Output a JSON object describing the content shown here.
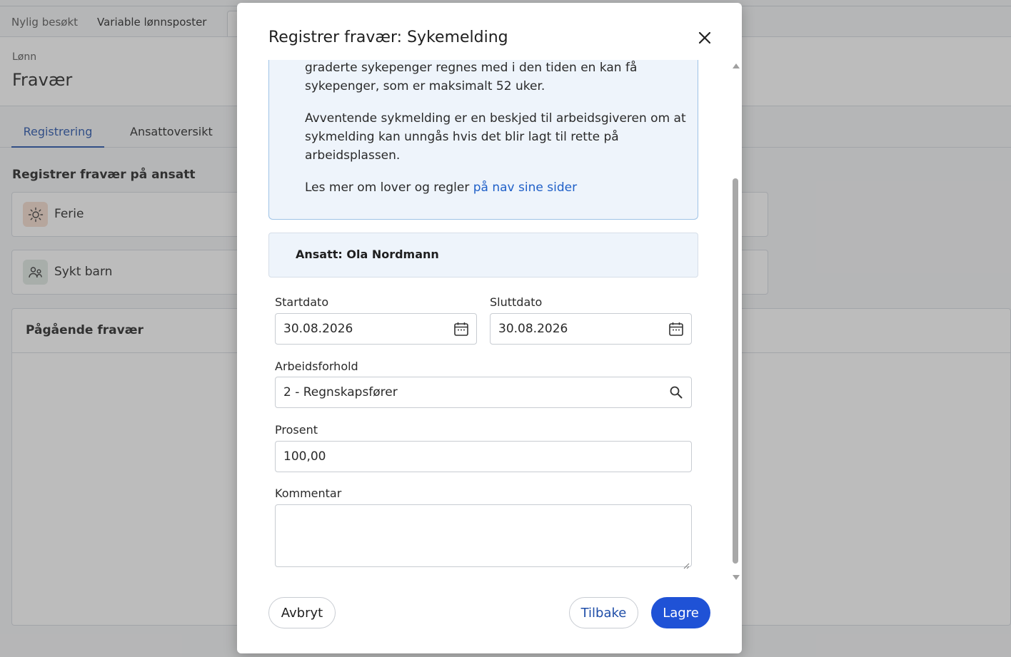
{
  "background": {
    "recent_label": "Nylig besøkt",
    "recent_tab": "Variable lønnsposter",
    "breadcrumb": "Lønn",
    "page_title": "Fravær",
    "tabs": [
      "Registrering",
      "Ansattoversikt"
    ],
    "section_title": "Registrer fravær på ansatt",
    "cards": [
      {
        "label": "Ferie",
        "icon": "sun-icon"
      },
      {
        "label": "Sykt barn",
        "icon": "people-icon"
      }
    ],
    "ongoing_title": "Pågående fravær"
  },
  "modal": {
    "title": "Registrer fravær: Sykemelding",
    "info": {
      "p1": "graderte sykepenger regnes med i den tiden en kan få sykepenger, som er maksimalt 52 uker.",
      "p2": "Avventende sykmelding er en beskjed til arbeidsgiveren om at sykmelding kan unngås hvis det blir lagt til rette på arbeidsplassen.",
      "p3_text": "Les mer om lover og regler ",
      "p3_link": "på nav sine sider"
    },
    "employee": "Ansatt: Ola Nordmann",
    "fields": {
      "start_label": "Startdato",
      "start_value": "30.08.2026",
      "end_label": "Sluttdato",
      "end_value": "30.08.2026",
      "employment_label": "Arbeidsforhold",
      "employment_value": "2 - Regnskapsfører",
      "percent_label": "Prosent",
      "percent_value": "100,00",
      "comment_label": "Kommentar",
      "comment_value": ""
    },
    "buttons": {
      "cancel": "Avbryt",
      "back": "Tilbake",
      "save": "Lagre"
    }
  },
  "colors": {
    "accent": "#1f52d6",
    "link": "#2060c8",
    "info_bg": "#eef4fb",
    "info_border": "#9fc3e6"
  }
}
